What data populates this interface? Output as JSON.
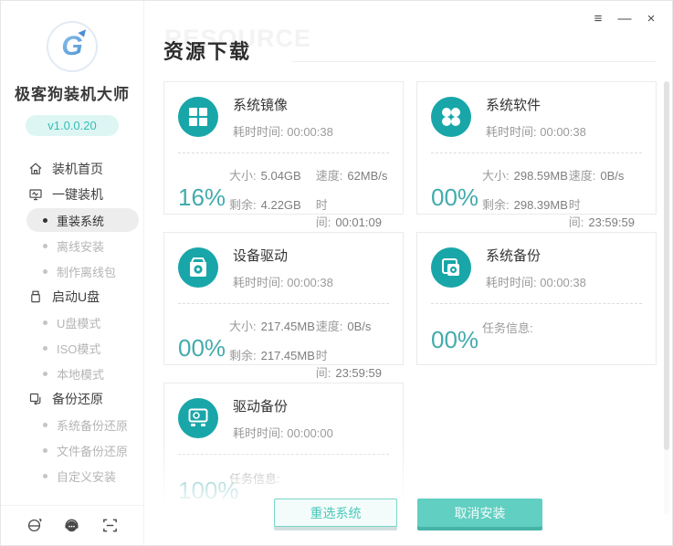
{
  "window": {
    "menu_glyph": "≡",
    "minimize_glyph": "—",
    "close_glyph": "×"
  },
  "sidebar": {
    "app_name": "极客狗装机大师",
    "version": "v1.0.0.20",
    "nav": [
      {
        "label": "装机首页",
        "type": "top",
        "icon": "home-icon"
      },
      {
        "label": "一键装机",
        "type": "top",
        "icon": "monitor-icon"
      },
      {
        "label": "重装系统",
        "type": "sub",
        "active": true
      },
      {
        "label": "离线安装",
        "type": "sub"
      },
      {
        "label": "制作离线包",
        "type": "sub"
      },
      {
        "label": "启动U盘",
        "type": "top",
        "icon": "usb-drive-icon"
      },
      {
        "label": "U盘模式",
        "type": "sub"
      },
      {
        "label": "ISO模式",
        "type": "sub"
      },
      {
        "label": "本地模式",
        "type": "sub"
      },
      {
        "label": "备份还原",
        "type": "top",
        "icon": "restore-icon"
      },
      {
        "label": "系统备份还原",
        "type": "sub"
      },
      {
        "label": "文件备份还原",
        "type": "sub"
      },
      {
        "label": "自定义安装",
        "type": "sub"
      }
    ],
    "footer_icons": [
      "ie-browser-icon",
      "support-headset-icon",
      "scan-icon"
    ]
  },
  "header": {
    "title": "资源下载",
    "watermark": "RESOURCE"
  },
  "cards": [
    {
      "title": "系统镜像",
      "icon": "windows-logo-icon",
      "elapsed_label": "耗时时间:",
      "elapsed_value": "00:00:38",
      "percent": "16%",
      "stats": [
        {
          "k": "大小:",
          "v": "5.04GB"
        },
        {
          "k": "速度:",
          "v": "62MB/s"
        },
        {
          "k": "剩余:",
          "v": "4.22GB"
        },
        {
          "k": "时间:",
          "v": "00:01:09"
        }
      ]
    },
    {
      "title": "系统软件",
      "icon": "apps-icon",
      "elapsed_label": "耗时时间:",
      "elapsed_value": "00:00:38",
      "percent": "00%",
      "stats": [
        {
          "k": "大小:",
          "v": "298.59MB"
        },
        {
          "k": "速度:",
          "v": "0B/s"
        },
        {
          "k": "剩余:",
          "v": "298.39MB"
        },
        {
          "k": "时间:",
          "v": "23:59:59"
        }
      ]
    },
    {
      "title": "设备驱动",
      "icon": "device-driver-icon",
      "elapsed_label": "耗时时间:",
      "elapsed_value": "00:00:38",
      "percent": "00%",
      "stats": [
        {
          "k": "大小:",
          "v": "217.45MB"
        },
        {
          "k": "速度:",
          "v": "0B/s"
        },
        {
          "k": "剩余:",
          "v": "217.45MB"
        },
        {
          "k": "时间:",
          "v": "23:59:59"
        }
      ]
    },
    {
      "title": "系统备份",
      "icon": "system-backup-icon",
      "elapsed_label": "耗时时间:",
      "elapsed_value": "00:00:38",
      "percent": "00%",
      "info_label": "任务信息:"
    },
    {
      "title": "驱动备份",
      "icon": "drive-backup-icon",
      "elapsed_label": "耗时时间:",
      "elapsed_value": "00:00:00",
      "percent": "100%",
      "info_label": "任务信息:"
    }
  ],
  "buttons": {
    "reselect": "重选系统",
    "cancel": "取消安装"
  },
  "colors": {
    "accent_teal": "#18a6a9",
    "percent_teal": "#43abad",
    "cancel_button": "#61cfc2",
    "version_pill_bg": "#ddf6f4"
  }
}
